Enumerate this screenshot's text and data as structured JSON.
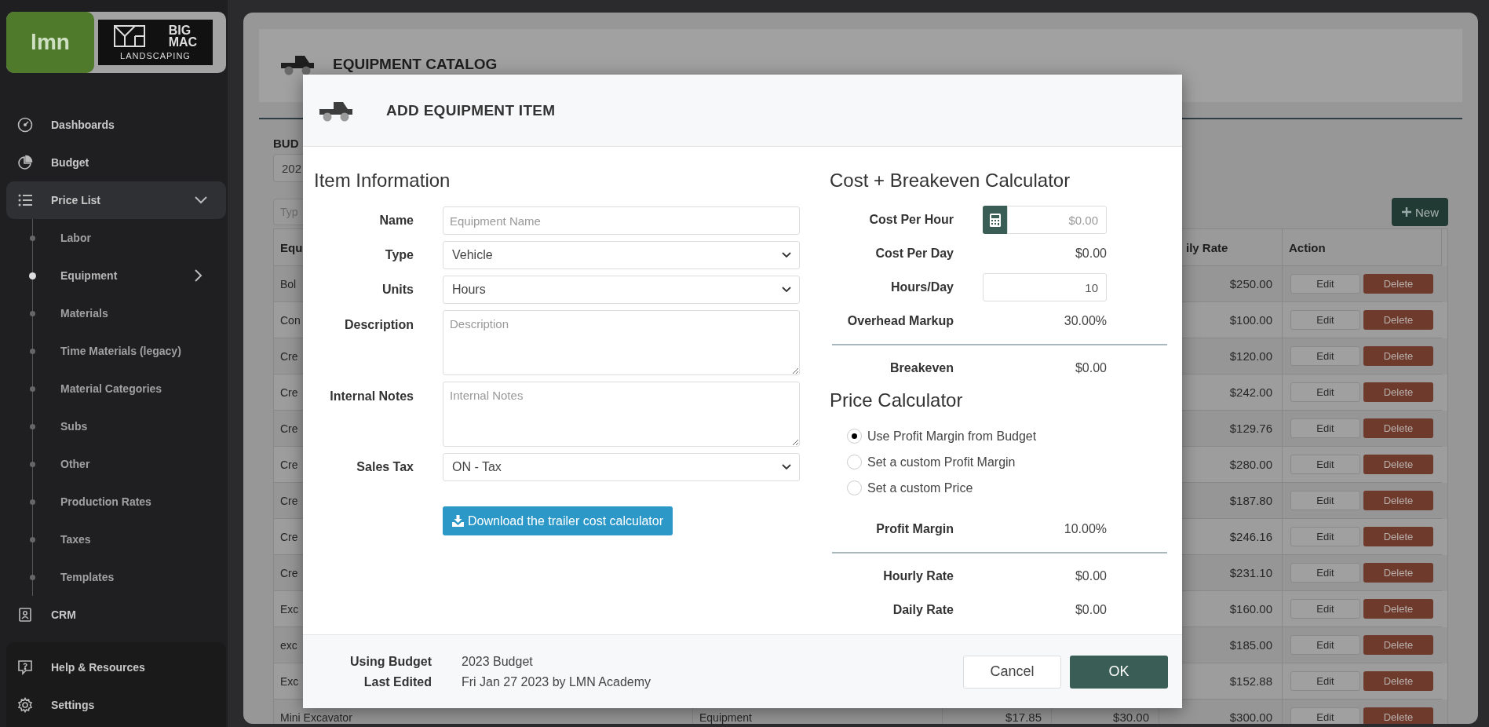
{
  "sidebar": {
    "logo": "lmn",
    "brand": {
      "lines": [
        "BIG",
        "MAC"
      ],
      "sub": "LANDSCAPING"
    },
    "items": [
      {
        "label": "Dashboards",
        "expanded": false
      },
      {
        "label": "Budget",
        "expanded": false
      },
      {
        "label": "Price List",
        "expanded": true,
        "children": [
          {
            "label": "Labor",
            "selected": false
          },
          {
            "label": "Equipment",
            "selected": true
          },
          {
            "label": "Materials",
            "selected": false
          },
          {
            "label": "Time Materials (legacy)",
            "selected": false
          },
          {
            "label": "Material Categories",
            "selected": false
          },
          {
            "label": "Subs",
            "selected": false
          },
          {
            "label": "Other",
            "selected": false
          },
          {
            "label": "Production Rates",
            "selected": false
          },
          {
            "label": "Taxes",
            "selected": false
          },
          {
            "label": "Templates",
            "selected": false
          }
        ]
      },
      {
        "label": "CRM",
        "expanded": false
      }
    ],
    "bottom_items": [
      {
        "label": "Help & Resources"
      },
      {
        "label": "Settings"
      }
    ]
  },
  "page": {
    "title": "EQUIPMENT CATALOG",
    "budget_label": "BUD",
    "budget_select": "202",
    "search": {
      "placeholder": "Typ"
    },
    "new_button": "New",
    "table": {
      "columns": {
        "column_1": "Equ",
        "column_5": "ily Rate",
        "column_6": "Action"
      },
      "rows": [
        {
          "column_1": "Bol",
          "column_5": "$250.00",
          "actions": [
            "Edit",
            "Delete"
          ]
        },
        {
          "column_1": "Con",
          "column_5": "$100.00",
          "actions": [
            "Edit",
            "Delete"
          ]
        },
        {
          "column_1": "Cre",
          "column_5": "$120.00",
          "actions": [
            "Edit",
            "Delete"
          ]
        },
        {
          "column_1": "Cre",
          "column_5": "$242.00",
          "actions": [
            "Edit",
            "Delete"
          ]
        },
        {
          "column_1": "Cre",
          "column_5": "$129.76",
          "actions": [
            "Edit",
            "Delete"
          ]
        },
        {
          "column_1": "Cre",
          "column_5": "$280.00",
          "actions": [
            "Edit",
            "Delete"
          ]
        },
        {
          "column_1": "Cre",
          "column_5": "$187.80",
          "actions": [
            "Edit",
            "Delete"
          ]
        },
        {
          "column_1": "Cre",
          "column_5": "$246.16",
          "actions": [
            "Edit",
            "Delete"
          ]
        },
        {
          "column_1": "Cre",
          "column_5": "$231.10",
          "actions": [
            "Edit",
            "Delete"
          ]
        },
        {
          "column_1": "Exc",
          "column_5": "$160.00",
          "actions": [
            "Edit",
            "Delete"
          ]
        },
        {
          "column_1": "exc",
          "column_5": "$185.00",
          "actions": [
            "Edit",
            "Delete"
          ]
        },
        {
          "column_1": "Exc",
          "column_5": "$152.88",
          "actions": [
            "Edit",
            "Delete"
          ]
        },
        {
          "column_1": "Mini Excavator",
          "column_2": "Equipment",
          "column_3": "$17.85",
          "column_4": "$30.00",
          "column_5": "$300.00",
          "actions": [
            "Edit",
            "Delete"
          ]
        }
      ]
    }
  },
  "modal": {
    "title": "ADD EQUIPMENT ITEM",
    "item_info": {
      "title": "Item Information",
      "fields": [
        {
          "kind": "text",
          "label": "Name",
          "placeholder": "Equipment Name"
        },
        {
          "kind": "select",
          "label": "Type",
          "value": "Vehicle"
        },
        {
          "kind": "select",
          "label": "Units",
          "value": "Hours"
        },
        {
          "kind": "textarea",
          "label": "Description",
          "placeholder": "Description"
        },
        {
          "kind": "textarea",
          "label": "Internal Notes",
          "placeholder": "Internal Notes"
        },
        {
          "kind": "select",
          "label": "Sales Tax",
          "value": "ON - Tax"
        }
      ],
      "download_button": "Download the trailer cost calculator"
    },
    "cost": {
      "title": "Cost + Breakeven Calculator",
      "rows": [
        {
          "kind": "calc-input",
          "label": "Cost Per Hour",
          "placeholder": "$0.00"
        },
        {
          "kind": "text",
          "label": "Cost Per Day",
          "value": "$0.00"
        },
        {
          "kind": "input",
          "label": "Hours/Day",
          "value": "10"
        },
        {
          "kind": "text",
          "label": "Overhead Markup",
          "value": "30.00%"
        },
        {
          "kind": "total",
          "label": "Breakeven",
          "value": "$0.00"
        }
      ]
    },
    "price": {
      "title": "Price Calculator",
      "options": [
        {
          "label": "Use Profit Margin from Budget",
          "selected": true
        },
        {
          "label": "Set a custom Profit Margin",
          "selected": false
        },
        {
          "label": "Set a custom Price",
          "selected": false
        }
      ],
      "rows": [
        {
          "kind": "text",
          "label": "Profit Margin",
          "value": "10.00%"
        },
        {
          "kind": "total",
          "label": "Hourly Rate",
          "value": "$0.00"
        },
        {
          "kind": "text",
          "label": "Daily Rate",
          "value": "$0.00"
        }
      ]
    },
    "footer": {
      "info": [
        {
          "label": "Using Budget",
          "value": "2023 Budget"
        },
        {
          "label": "Last Edited",
          "value": "Fri Jan 27 2023 by LMN Academy"
        }
      ],
      "buttons": [
        {
          "label": "Cancel",
          "kind": "secondary"
        },
        {
          "label": "OK",
          "kind": "primary"
        }
      ]
    }
  }
}
